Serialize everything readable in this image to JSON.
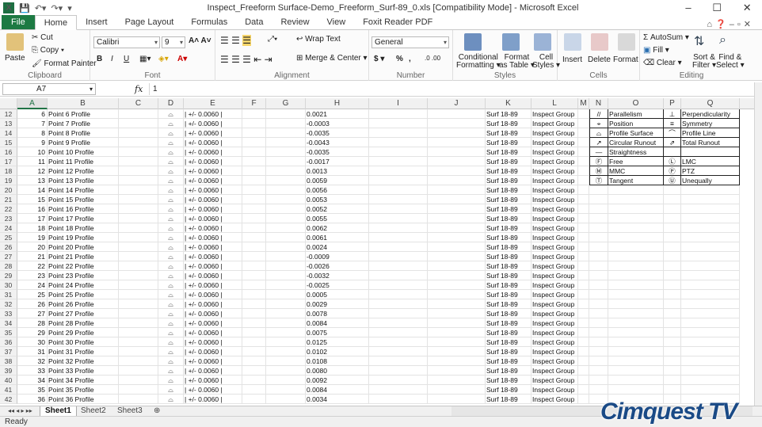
{
  "window": {
    "title": "Inspect_Freeform Surface-Demo_Freeform_Surf-89_0.xls  [Compatibility Mode]  -  Microsoft Excel",
    "min": "–",
    "max": "☐",
    "close": "✕"
  },
  "tabs": [
    "File",
    "Home",
    "Insert",
    "Page Layout",
    "Formulas",
    "Data",
    "Review",
    "View",
    "Foxit Reader PDF"
  ],
  "active_tab": "Home",
  "ribbon": {
    "clipboard": {
      "cut": "Cut",
      "copy": "Copy ▾",
      "paste": "Paste",
      "format_painter": "Format Painter",
      "label": "Clipboard"
    },
    "font": {
      "name": "Calibri",
      "size": "9",
      "bold": "B",
      "italic": "I",
      "underline": "U",
      "label": "Font"
    },
    "alignment": {
      "wrap": "Wrap Text",
      "merge": "Merge & Center ▾",
      "label": "Alignment"
    },
    "number": {
      "format": "General",
      "currency": "$ ▾",
      "percent": "%",
      "comma": ",",
      "label": "Number"
    },
    "styles": {
      "conditional": "Conditional",
      "conditional2": "Formatting ▾",
      "format_table": "Format",
      "format_table2": "as Table ▾",
      "cell": "Cell",
      "cell2": "Styles ▾",
      "label": "Styles"
    },
    "cells": {
      "insert": "Insert",
      "delete": "Delete",
      "format": "Format",
      "label": "Cells"
    },
    "editing": {
      "autosum": "Σ AutoSum ▾",
      "fill": "Fill ▾",
      "clear": "Clear ▾",
      "sort": "Sort &",
      "sort2": "Filter ▾",
      "find": "Find &",
      "find2": "Select ▾",
      "label": "Editing"
    }
  },
  "formula_bar": {
    "name_box": "A7",
    "fx": "fx",
    "content": "1"
  },
  "columns": [
    "A",
    "B",
    "C",
    "D",
    "E",
    "F",
    "G",
    "H",
    "I",
    "J",
    "K",
    "L",
    "M",
    "N",
    "O",
    "P",
    "Q"
  ],
  "rows": [
    {
      "r": "12",
      "a": "6",
      "b": "Point 6 Profile",
      "e": "| +/- 0.0060 |",
      "h": "0.0021"
    },
    {
      "r": "13",
      "a": "7",
      "b": "Point 7 Profile",
      "e": "| +/- 0.0060 |",
      "h": "-0.0003"
    },
    {
      "r": "14",
      "a": "8",
      "b": "Point 8 Profile",
      "e": "| +/- 0.0060 |",
      "h": "-0.0035"
    },
    {
      "r": "15",
      "a": "9",
      "b": "Point 9 Profile",
      "e": "| +/- 0.0060 |",
      "h": "-0.0043"
    },
    {
      "r": "16",
      "a": "10",
      "b": "Point 10 Profile",
      "e": "| +/- 0.0060 |",
      "h": "-0.0035"
    },
    {
      "r": "17",
      "a": "11",
      "b": "Point 11 Profile",
      "e": "| +/- 0.0060 |",
      "h": "-0.0017"
    },
    {
      "r": "18",
      "a": "12",
      "b": "Point 12 Profile",
      "e": "| +/- 0.0060 |",
      "h": "0.0013"
    },
    {
      "r": "19",
      "a": "13",
      "b": "Point 13 Profile",
      "e": "| +/- 0.0060 |",
      "h": "0.0059"
    },
    {
      "r": "20",
      "a": "14",
      "b": "Point 14 Profile",
      "e": "| +/- 0.0060 |",
      "h": "0.0056"
    },
    {
      "r": "21",
      "a": "15",
      "b": "Point 15 Profile",
      "e": "| +/- 0.0060 |",
      "h": "0.0053"
    },
    {
      "r": "22",
      "a": "16",
      "b": "Point 16 Profile",
      "e": "| +/- 0.0060 |",
      "h": "0.0052"
    },
    {
      "r": "23",
      "a": "17",
      "b": "Point 17 Profile",
      "e": "| +/- 0.0060 |",
      "h": "0.0055"
    },
    {
      "r": "24",
      "a": "18",
      "b": "Point 18 Profile",
      "e": "| +/- 0.0060 |",
      "h": "0.0062"
    },
    {
      "r": "25",
      "a": "19",
      "b": "Point 19 Profile",
      "e": "| +/- 0.0060 |",
      "h": "0.0061"
    },
    {
      "r": "26",
      "a": "20",
      "b": "Point 20 Profile",
      "e": "| +/- 0.0060 |",
      "h": "0.0024"
    },
    {
      "r": "27",
      "a": "21",
      "b": "Point 21 Profile",
      "e": "| +/- 0.0060 |",
      "h": "-0.0009"
    },
    {
      "r": "28",
      "a": "22",
      "b": "Point 22 Profile",
      "e": "| +/- 0.0060 |",
      "h": "-0.0026"
    },
    {
      "r": "29",
      "a": "23",
      "b": "Point 23 Profile",
      "e": "| +/- 0.0060 |",
      "h": "-0.0032"
    },
    {
      "r": "30",
      "a": "24",
      "b": "Point 24 Profile",
      "e": "| +/- 0.0060 |",
      "h": "-0.0025"
    },
    {
      "r": "31",
      "a": "25",
      "b": "Point 25 Profile",
      "e": "| +/- 0.0060 |",
      "h": "0.0005"
    },
    {
      "r": "32",
      "a": "26",
      "b": "Point 26 Profile",
      "e": "| +/- 0.0060 |",
      "h": "0.0029"
    },
    {
      "r": "33",
      "a": "27",
      "b": "Point 27 Profile",
      "e": "| +/- 0.0060 |",
      "h": "0.0078"
    },
    {
      "r": "34",
      "a": "28",
      "b": "Point 28 Profile",
      "e": "| +/- 0.0060 |",
      "h": "0.0084"
    },
    {
      "r": "35",
      "a": "29",
      "b": "Point 29 Profile",
      "e": "| +/- 0.0060 |",
      "h": "0.0075"
    },
    {
      "r": "36",
      "a": "30",
      "b": "Point 30 Profile",
      "e": "| +/- 0.0060 |",
      "h": "0.0125"
    },
    {
      "r": "37",
      "a": "31",
      "b": "Point 31 Profile",
      "e": "| +/- 0.0060 |",
      "h": "0.0102"
    },
    {
      "r": "38",
      "a": "32",
      "b": "Point 32 Profile",
      "e": "| +/- 0.0060 |",
      "h": "0.0108"
    },
    {
      "r": "39",
      "a": "33",
      "b": "Point 33 Profile",
      "e": "| +/- 0.0060 |",
      "h": "0.0080"
    },
    {
      "r": "40",
      "a": "34",
      "b": "Point 34 Profile",
      "e": "| +/- 0.0060 |",
      "h": "0.0092"
    },
    {
      "r": "41",
      "a": "35",
      "b": "Point 35 Profile",
      "e": "| +/- 0.0060 |",
      "h": "0.0084"
    },
    {
      "r": "42",
      "a": "36",
      "b": "Point 36 Profile",
      "e": "| +/- 0.0060 |",
      "h": "0.0034"
    }
  ],
  "common": {
    "d_symbol": "⌓",
    "k": "Surf 18-89",
    "l": "Inspect Group"
  },
  "legend": [
    {
      "s1": "//",
      "n1": "Parallelism",
      "s2": "⊥",
      "n2": "Perpendicularity"
    },
    {
      "s1": "⌖",
      "n1": "Position",
      "s2": "≡",
      "n2": "Symmetry"
    },
    {
      "s1": "⌓",
      "n1": "Profile Surface",
      "s2": "⌒",
      "n2": "Profile Line"
    },
    {
      "s1": "↗",
      "n1": "Circular Runout",
      "s2": "⇗",
      "n2": "Total Runout"
    },
    {
      "s1": "—",
      "n1": "Straightness",
      "s2": "",
      "n2": ""
    },
    {
      "s1": "Ⓕ",
      "n1": "Free",
      "s2": "Ⓛ",
      "n2": "LMC"
    },
    {
      "s1": "Ⓜ",
      "n1": "MMC",
      "s2": "Ⓟ",
      "n2": "PTZ"
    },
    {
      "s1": "Ⓣ",
      "n1": "Tangent",
      "s2": "Ⓤ",
      "n2": "Unequally"
    }
  ],
  "sheets": [
    "Sheet1",
    "Sheet2",
    "Sheet3"
  ],
  "status": "Ready",
  "watermark": "Cimquest TV"
}
